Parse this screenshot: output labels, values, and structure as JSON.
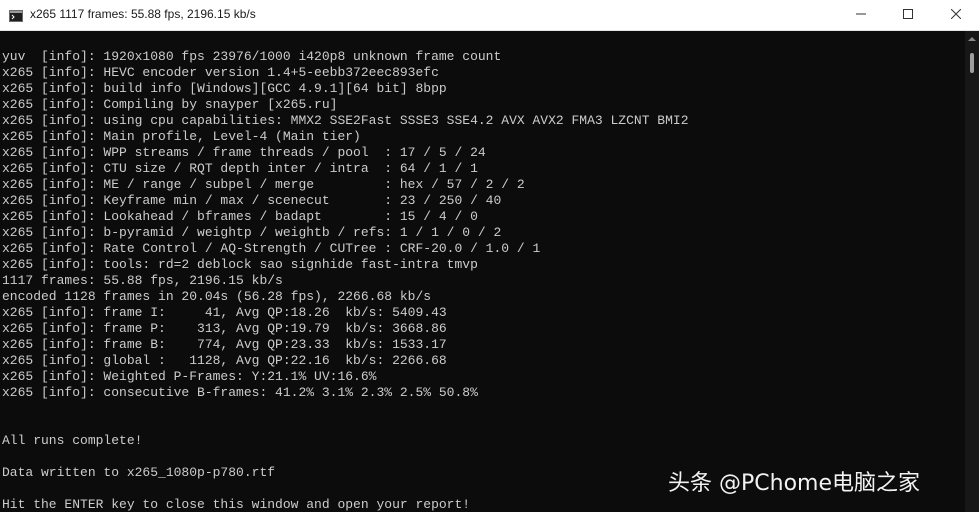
{
  "window": {
    "title": "x265 1117 frames: 55.88 fps, 2196.15 kb/s"
  },
  "console": {
    "lines": [
      "yuv  [info]: 1920x1080 fps 23976/1000 i420p8 unknown frame count",
      "x265 [info]: HEVC encoder version 1.4+5-eebb372eec893efc",
      "x265 [info]: build info [Windows][GCC 4.9.1][64 bit] 8bpp",
      "x265 [info]: Compiling by snayper [x265.ru]",
      "x265 [info]: using cpu capabilities: MMX2 SSE2Fast SSSE3 SSE4.2 AVX AVX2 FMA3 LZCNT BMI2",
      "x265 [info]: Main profile, Level-4 (Main tier)",
      "x265 [info]: WPP streams / frame threads / pool  : 17 / 5 / 24",
      "x265 [info]: CTU size / RQT depth inter / intra  : 64 / 1 / 1",
      "x265 [info]: ME / range / subpel / merge         : hex / 57 / 2 / 2",
      "x265 [info]: Keyframe min / max / scenecut       : 23 / 250 / 40",
      "x265 [info]: Lookahead / bframes / badapt        : 15 / 4 / 0",
      "x265 [info]: b-pyramid / weightp / weightb / refs: 1 / 1 / 0 / 2",
      "x265 [info]: Rate Control / AQ-Strength / CUTree : CRF-20.0 / 1.0 / 1",
      "x265 [info]: tools: rd=2 deblock sao signhide fast-intra tmvp",
      "1117 frames: 55.88 fps, 2196.15 kb/s",
      "encoded 1128 frames in 20.04s (56.28 fps), 2266.68 kb/s",
      "x265 [info]: frame I:     41, Avg QP:18.26  kb/s: 5409.43",
      "x265 [info]: frame P:    313, Avg QP:19.79  kb/s: 3668.86",
      "x265 [info]: frame B:    774, Avg QP:23.33  kb/s: 1533.17",
      "x265 [info]: global :   1128, Avg QP:22.16  kb/s: 2266.68",
      "x265 [info]: Weighted P-Frames: Y:21.1% UV:16.6%",
      "x265 [info]: consecutive B-frames: 41.2% 3.1% 2.3% 2.5% 50.8%",
      "",
      "",
      "All runs complete!",
      "",
      "Data written to x265_1080p-p780.rtf",
      "",
      "Hit the ENTER key to close this window and open your report!"
    ]
  },
  "watermark": {
    "text": "头条 @PChome电脑之家"
  },
  "colors": {
    "console_bg": "#0c0c0c",
    "console_fg": "#cccccc",
    "titlebar_bg": "#ffffff"
  },
  "icons": {
    "app": "console-app-icon",
    "minimize": "minimize-icon",
    "maximize": "maximize-icon",
    "close": "close-icon"
  }
}
